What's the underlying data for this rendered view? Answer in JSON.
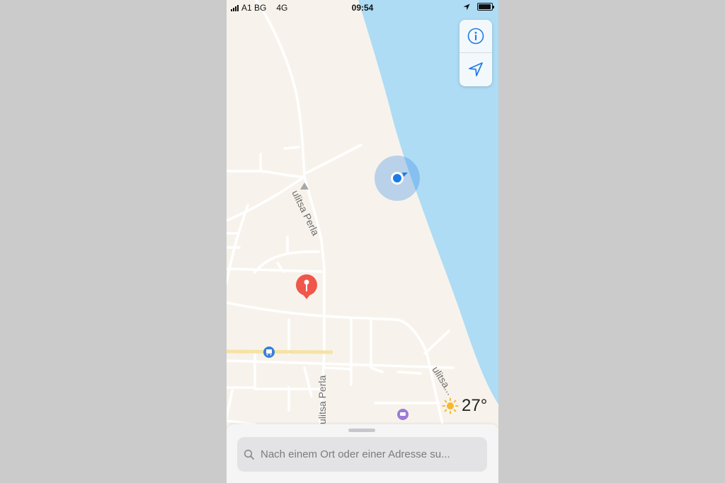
{
  "status_bar": {
    "carrier": "A1 BG",
    "network": "4G",
    "time": "09:54"
  },
  "map": {
    "street_labels": [
      "ulitsa Perla",
      "ulitsa Perla",
      "ulitsa..."
    ],
    "water_color": "#aedcf4",
    "land_color": "#f7f3ec",
    "user_location_color": "#1e7be6",
    "pin_color": "#f0564a"
  },
  "controls": {
    "info_icon": "info-icon",
    "location_icon": "location-arrow-icon"
  },
  "weather": {
    "icon": "sun-icon",
    "temperature": "27°"
  },
  "search": {
    "placeholder": "Nach einem Ort oder einer Adresse su..."
  }
}
